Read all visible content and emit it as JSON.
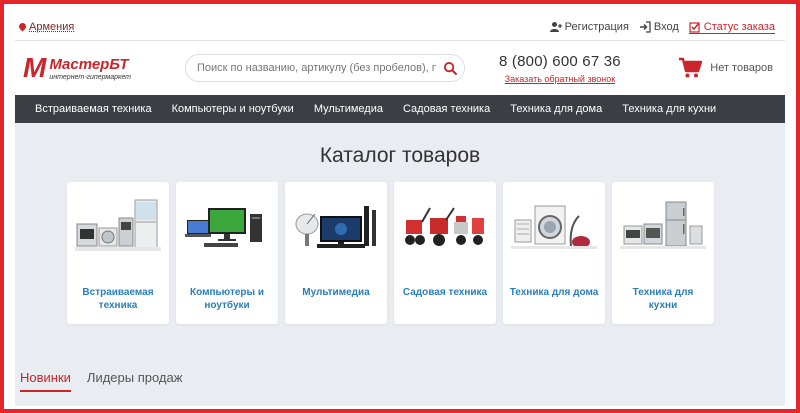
{
  "topbar": {
    "location": "Армения",
    "register": "Регистрация",
    "login": "Вход",
    "order_status": "Статус заказа"
  },
  "header": {
    "logo_letter": "М",
    "logo_name": "МастерБТ",
    "logo_sub": "интернет-гипермаркет",
    "search_placeholder": "Поиск по названию, артикулу (без пробелов), производителю",
    "phone": "8 (800) 600 67 36",
    "callback": "Заказать обратный звонок",
    "cart": "Нет товаров"
  },
  "nav": [
    {
      "label": "Встраиваемая техника"
    },
    {
      "label": "Компьютеры и ноутбуки"
    },
    {
      "label": "Мультимедиа"
    },
    {
      "label": "Садовая техника"
    },
    {
      "label": "Техника для дома"
    },
    {
      "label": "Техника для кухни"
    }
  ],
  "catalog": {
    "title": "Каталог товаров",
    "cards": [
      {
        "label": "Встраиваемая техника",
        "icon": "built-in-appliances-image"
      },
      {
        "label": "Компьютеры и ноутбуки",
        "icon": "computers-image"
      },
      {
        "label": "Мультимедиа",
        "icon": "multimedia-image"
      },
      {
        "label": "Садовая техника",
        "icon": "garden-equipment-image"
      },
      {
        "label": "Техника для дома",
        "icon": "home-appliances-image"
      },
      {
        "label": "Техника для кухни",
        "icon": "kitchen-appliances-image"
      }
    ]
  },
  "tabs": [
    {
      "label": "Новинки",
      "active": true
    },
    {
      "label": "Лидеры продаж",
      "active": false
    }
  ],
  "colors": {
    "brand": "#c9252b",
    "nav_bg": "#3b3f44",
    "link": "#2a7fb8"
  }
}
